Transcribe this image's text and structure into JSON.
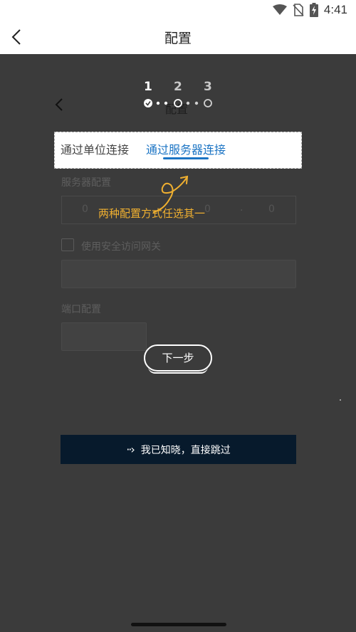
{
  "status_bar": {
    "time": "4:41",
    "icons": [
      "wifi-icon",
      "no-sim-icon",
      "battery-charging-icon"
    ]
  },
  "app_bar": {
    "title": "配置",
    "back_icon": "chevron-left-icon"
  },
  "background_page": {
    "title": "配置",
    "server_config_label": "服务器配置",
    "ip_parts": [
      "0",
      "0",
      "0",
      "0"
    ],
    "secure_gateway_label": "使用安全访问网关",
    "port_label": "端口配置"
  },
  "guide": {
    "steps": [
      {
        "number": "1",
        "state": "done"
      },
      {
        "number": "2",
        "state": "current"
      },
      {
        "number": "3",
        "state": "pending"
      }
    ],
    "tabs": [
      {
        "label": "通过单位连接",
        "active": false
      },
      {
        "label": "通过服务器连接",
        "active": true
      }
    ],
    "hint": "两种配置方式任选其一",
    "next_label": "下一步",
    "skip_label": "我已知晓，直接跳过"
  },
  "colors": {
    "overlay": "#3b3b3b",
    "accent": "#1b74c4",
    "hint": "#f0b030",
    "skip_bg": "#071a2c"
  }
}
